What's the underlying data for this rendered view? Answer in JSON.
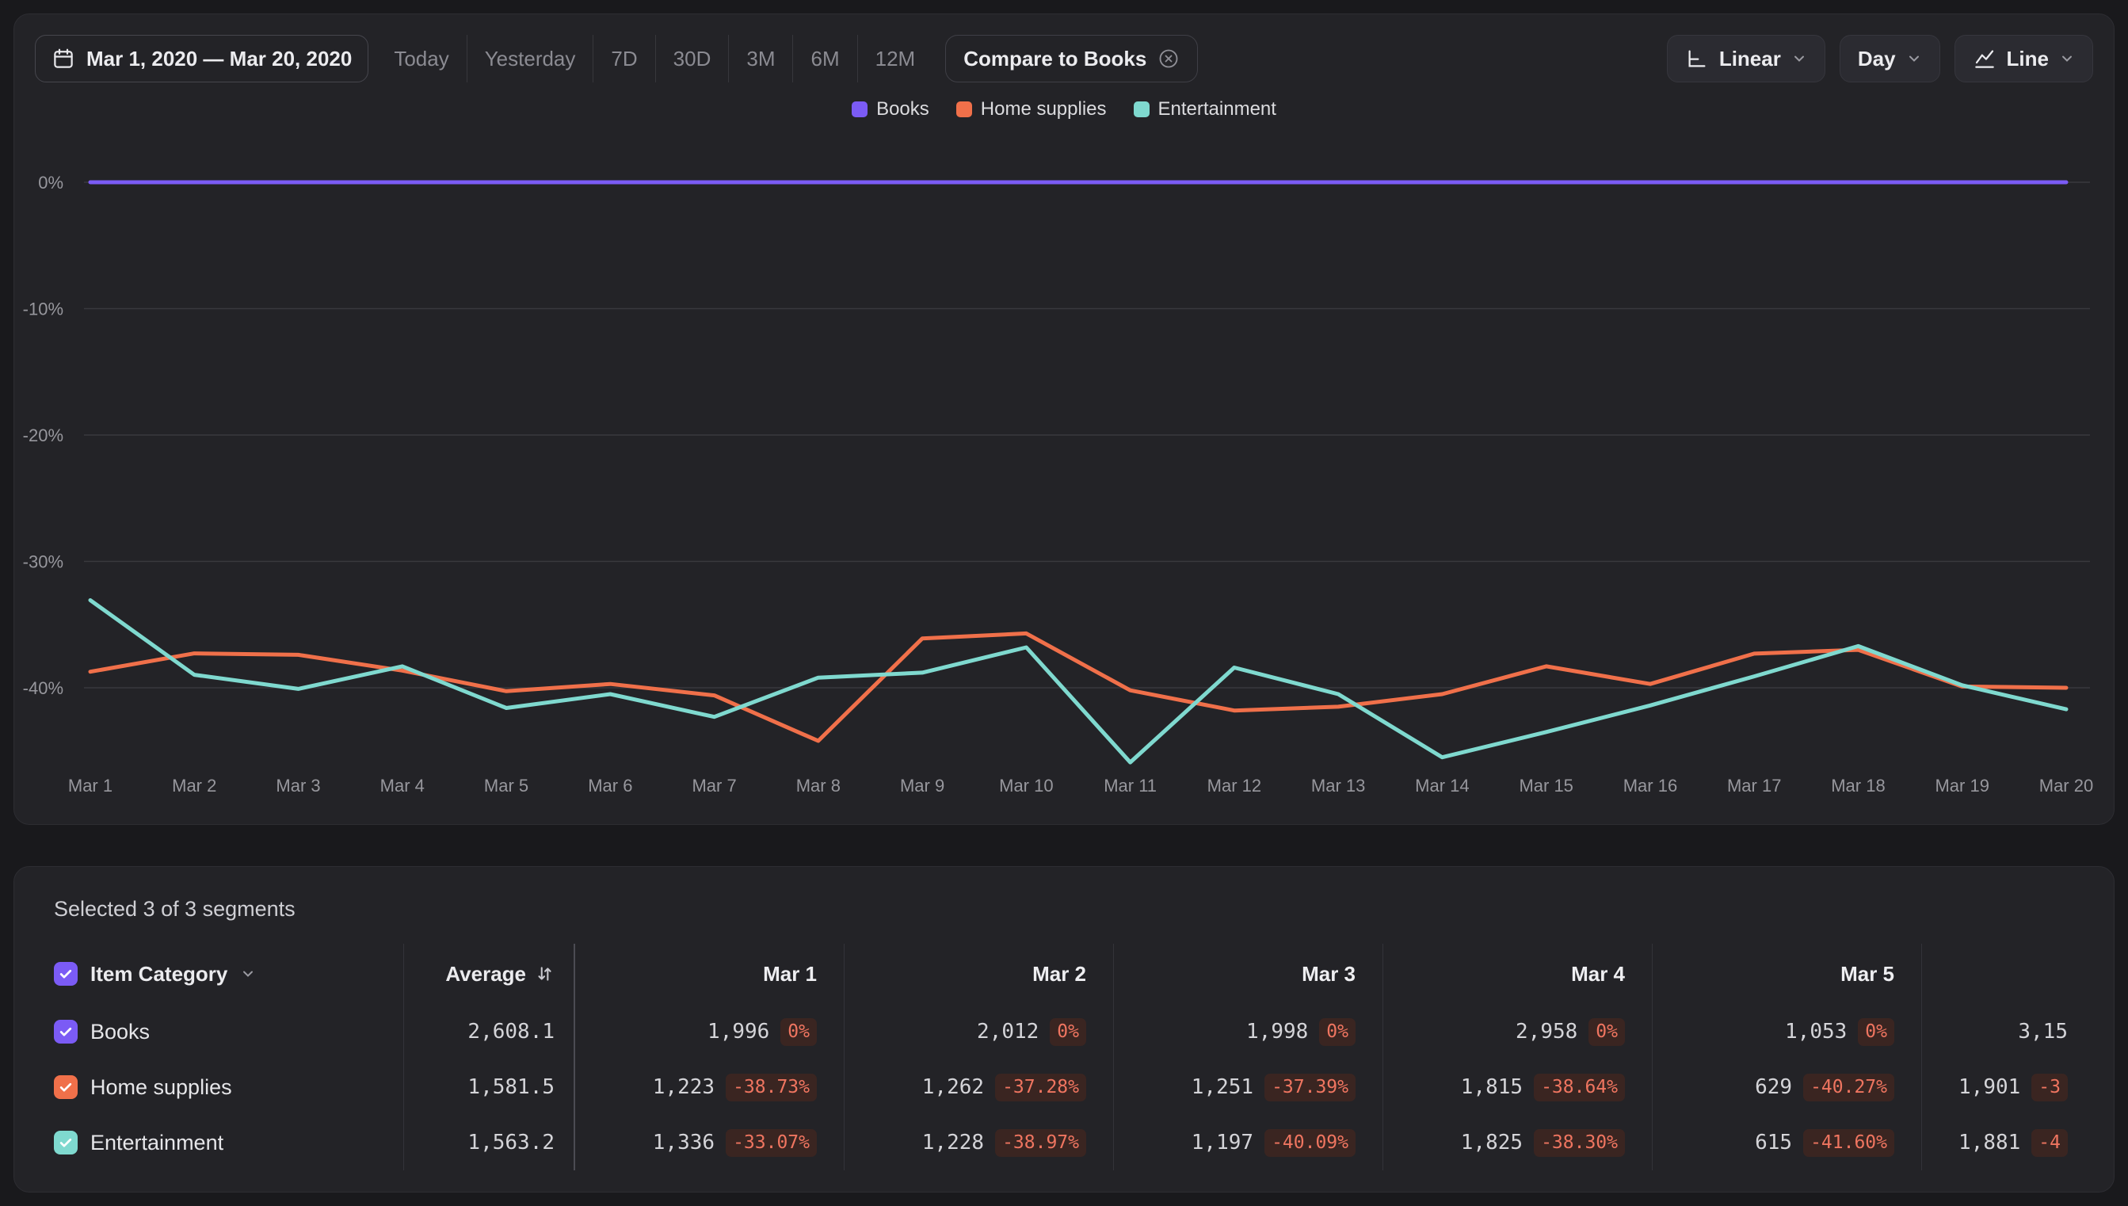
{
  "toolbar": {
    "date_range": "Mar 1, 2020 — Mar 20, 2020",
    "quick_ranges": [
      "Today",
      "Yesterday",
      "7D",
      "30D",
      "3M",
      "6M",
      "12M"
    ],
    "compare_label": "Compare to Books",
    "scale_dropdown": "Linear",
    "granularity_dropdown": "Day",
    "chart_type_dropdown": "Line"
  },
  "colors": {
    "books": "#7b5bf5",
    "home_supplies": "#f0704a",
    "entertainment": "#7fd9cf",
    "negative_badge_text": "#ef7560",
    "grid": "#39393e"
  },
  "legend": [
    {
      "label": "Books",
      "color": "#7b5bf5"
    },
    {
      "label": "Home supplies",
      "color": "#f0704a"
    },
    {
      "label": "Entertainment",
      "color": "#7fd9cf"
    }
  ],
  "chart_data": {
    "type": "line",
    "unit": "%",
    "x": [
      "Mar 1",
      "Mar 2",
      "Mar 3",
      "Mar 4",
      "Mar 5",
      "Mar 6",
      "Mar 7",
      "Mar 8",
      "Mar 9",
      "Mar 10",
      "Mar 11",
      "Mar 12",
      "Mar 13",
      "Mar 14",
      "Mar 15",
      "Mar 16",
      "Mar 17",
      "Mar 18",
      "Mar 19",
      "Mar 20"
    ],
    "y_ticks": [
      "0%",
      "-10%",
      "-20%",
      "-30%",
      "-40%"
    ],
    "ylim": [
      -48,
      2
    ],
    "grid": "horizontal",
    "legend_position": "top",
    "series": [
      {
        "name": "Books",
        "color": "#7b5bf5",
        "values": [
          0,
          0,
          0,
          0,
          0,
          0,
          0,
          0,
          0,
          0,
          0,
          0,
          0,
          0,
          0,
          0,
          0,
          0,
          0,
          0
        ]
      },
      {
        "name": "Home supplies",
        "color": "#f0704a",
        "values": [
          -38.73,
          -37.28,
          -37.39,
          -38.64,
          -40.27,
          -39.7,
          -40.6,
          -44.2,
          -36.1,
          -35.7,
          -40.2,
          -41.8,
          -41.5,
          -40.5,
          -38.3,
          -39.7,
          -37.3,
          -37.0,
          -39.9,
          -40.0
        ]
      },
      {
        "name": "Entertainment",
        "color": "#7fd9cf",
        "values": [
          -33.07,
          -38.97,
          -40.09,
          -38.3,
          -41.6,
          -40.5,
          -42.3,
          -39.2,
          -38.8,
          -36.8,
          -45.9,
          -38.4,
          -40.5,
          -45.5,
          -43.5,
          -41.4,
          -39.1,
          -36.7,
          -39.8,
          -41.7
        ]
      }
    ]
  },
  "table": {
    "selected_text": "Selected 3 of 3 segments",
    "header": {
      "category": "Item Category",
      "checkbox_color": "#7b5bf5",
      "average": "Average",
      "dates": [
        "Mar 1",
        "Mar 2",
        "Mar 3",
        "Mar 4",
        "Mar 5",
        ""
      ]
    },
    "rows": [
      {
        "label": "Books",
        "color": "#7b5bf5",
        "average": "2,608.1",
        "cells": [
          {
            "value": "1,996",
            "pct": "0%"
          },
          {
            "value": "2,012",
            "pct": "0%"
          },
          {
            "value": "1,998",
            "pct": "0%"
          },
          {
            "value": "2,958",
            "pct": "0%"
          },
          {
            "value": "1,053",
            "pct": "0%"
          },
          {
            "value": "3,15",
            "pct": ""
          }
        ]
      },
      {
        "label": "Home supplies",
        "color": "#f0704a",
        "average": "1,581.5",
        "cells": [
          {
            "value": "1,223",
            "pct": "-38.73%"
          },
          {
            "value": "1,262",
            "pct": "-37.28%"
          },
          {
            "value": "1,251",
            "pct": "-37.39%"
          },
          {
            "value": "1,815",
            "pct": "-38.64%"
          },
          {
            "value": "629",
            "pct": "-40.27%"
          },
          {
            "value": "1,901",
            "pct": "-3"
          }
        ]
      },
      {
        "label": "Entertainment",
        "color": "#7fd9cf",
        "average": "1,563.2",
        "cells": [
          {
            "value": "1,336",
            "pct": "-33.07%"
          },
          {
            "value": "1,228",
            "pct": "-38.97%"
          },
          {
            "value": "1,197",
            "pct": "-40.09%"
          },
          {
            "value": "1,825",
            "pct": "-38.30%"
          },
          {
            "value": "615",
            "pct": "-41.60%"
          },
          {
            "value": "1,881",
            "pct": "-4"
          }
        ]
      }
    ]
  }
}
